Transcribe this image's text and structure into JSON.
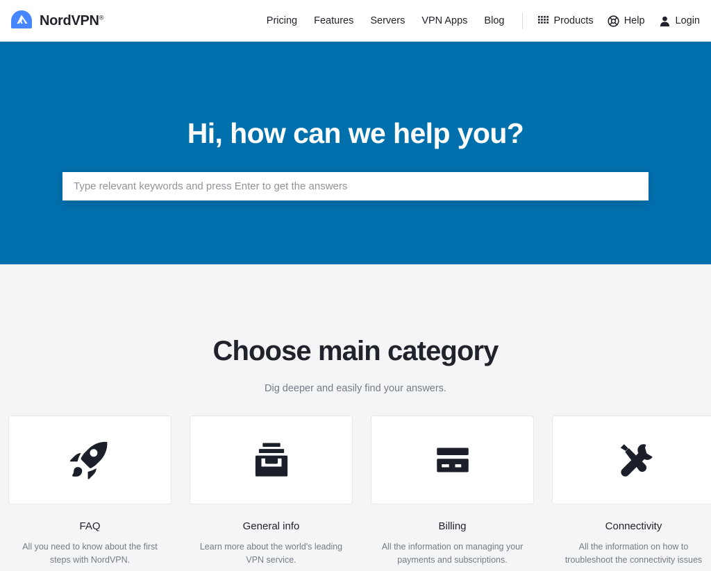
{
  "header": {
    "brand": {
      "name": "NordVPN",
      "registered_mark": "®",
      "logo_icon": "nordvpn-mountain-icon",
      "logo_color": "#4687ff"
    },
    "nav_links": [
      {
        "label": "Pricing"
      },
      {
        "label": "Features"
      },
      {
        "label": "Servers"
      },
      {
        "label": "VPN Apps"
      },
      {
        "label": "Blog"
      }
    ],
    "nav_actions": [
      {
        "label": "Products",
        "icon": "grid-dots-icon"
      },
      {
        "label": "Help",
        "icon": "lifebuoy-icon"
      },
      {
        "label": "Login",
        "icon": "user-icon"
      }
    ]
  },
  "hero": {
    "title": "Hi, how can we help you?",
    "background_color": "#0070ad",
    "search": {
      "placeholder": "Type relevant keywords and press Enter to get the answers",
      "value": ""
    }
  },
  "main": {
    "section_title": "Choose main category",
    "section_subtitle": "Dig deeper and easily find your answers.",
    "cards": [
      {
        "icon": "rocket-icon",
        "title": "FAQ",
        "description": "All you need to know about the first steps with NordVPN."
      },
      {
        "icon": "archive-box-icon",
        "title": "General info",
        "description": "Learn more about the world's leading VPN service."
      },
      {
        "icon": "credit-card-icon",
        "title": "Billing",
        "description": "All the information on managing your payments and subscriptions."
      },
      {
        "icon": "tools-icon",
        "title": "Connectivity",
        "description": "All the information on how to troubleshoot the connectivity issues"
      }
    ]
  }
}
